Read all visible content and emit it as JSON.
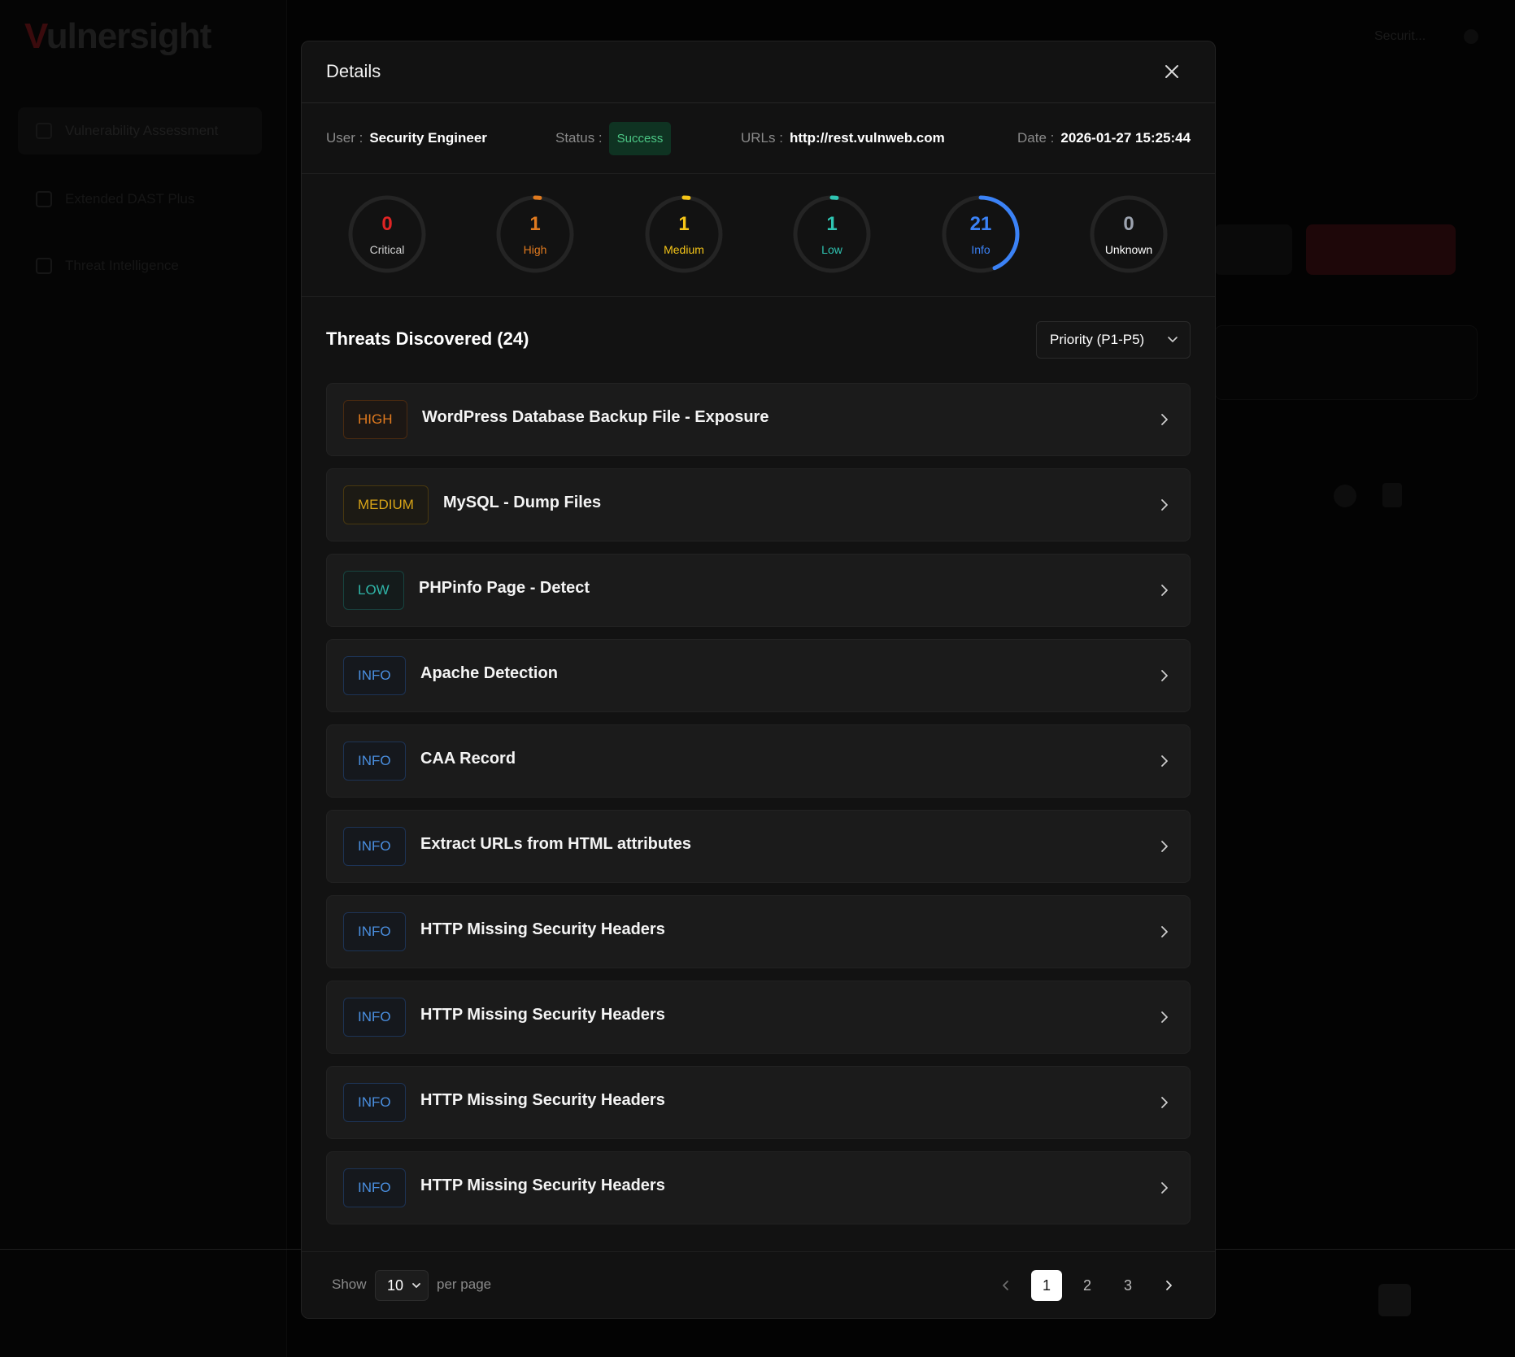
{
  "background": {
    "logo_first": "V",
    "logo_rest": "ulnersight",
    "nav": [
      "Vulnerability Assessment",
      "Extended DAST Plus",
      "Threat Intelligence"
    ],
    "top_right": "Securit..."
  },
  "modal": {
    "title": "Details",
    "info": {
      "user_label": "User :",
      "user_value": "Security Engineer",
      "status_label": "Status :",
      "status_value": "Success",
      "urls_label": "URLs :",
      "urls_value": "http://rest.vulnweb.com",
      "date_label": "Date :",
      "date_value": "2026-01-27 15:25:44"
    },
    "stats": [
      {
        "label": "Critical",
        "count": "0",
        "value": 0,
        "color": "#e02424"
      },
      {
        "label": "High",
        "count": "1",
        "value": 1,
        "color": "#e07a1f"
      },
      {
        "label": "Medium",
        "count": "1",
        "value": 1,
        "color": "#f5c518"
      },
      {
        "label": "Low",
        "count": "1",
        "value": 1,
        "color": "#2fc4b2"
      },
      {
        "label": "Info",
        "count": "21",
        "value": 21,
        "color": "#3b82f6"
      },
      {
        "label": "Unknown",
        "count": "0",
        "value": 0,
        "color": "#9ca3af"
      }
    ],
    "stats_total": 24,
    "threats_title": "Threats Discovered (24)",
    "sort_label": "Priority (P1-P5)",
    "threats": [
      {
        "severity": "HIGH",
        "level": "high",
        "title": "WordPress Database Backup File - Exposure"
      },
      {
        "severity": "MEDIUM",
        "level": "medium",
        "title": "MySQL - Dump Files"
      },
      {
        "severity": "LOW",
        "level": "low",
        "title": "PHPinfo Page - Detect"
      },
      {
        "severity": "INFO",
        "level": "info",
        "title": "Apache Detection"
      },
      {
        "severity": "INFO",
        "level": "info",
        "title": "CAA Record"
      },
      {
        "severity": "INFO",
        "level": "info",
        "title": "Extract URLs from HTML attributes"
      },
      {
        "severity": "INFO",
        "level": "info",
        "title": "HTTP Missing Security Headers"
      },
      {
        "severity": "INFO",
        "level": "info",
        "title": "HTTP Missing Security Headers"
      },
      {
        "severity": "INFO",
        "level": "info",
        "title": "HTTP Missing Security Headers"
      },
      {
        "severity": "INFO",
        "level": "info",
        "title": "HTTP Missing Security Headers"
      }
    ],
    "footer": {
      "show_label": "Show",
      "per_page_value": "10",
      "per_page_label": "per page",
      "pages": [
        "1",
        "2",
        "3"
      ],
      "current_page": "1"
    }
  },
  "colors": {
    "accent": "#3b82f6",
    "success_bg": "#0f3322",
    "success_text": "#4cc785"
  },
  "icons": {
    "close": "close-icon",
    "chevron_down": "chevron-down-icon",
    "chevron_right": "chevron-right-icon",
    "chevron_left": "chevron-left-icon"
  }
}
